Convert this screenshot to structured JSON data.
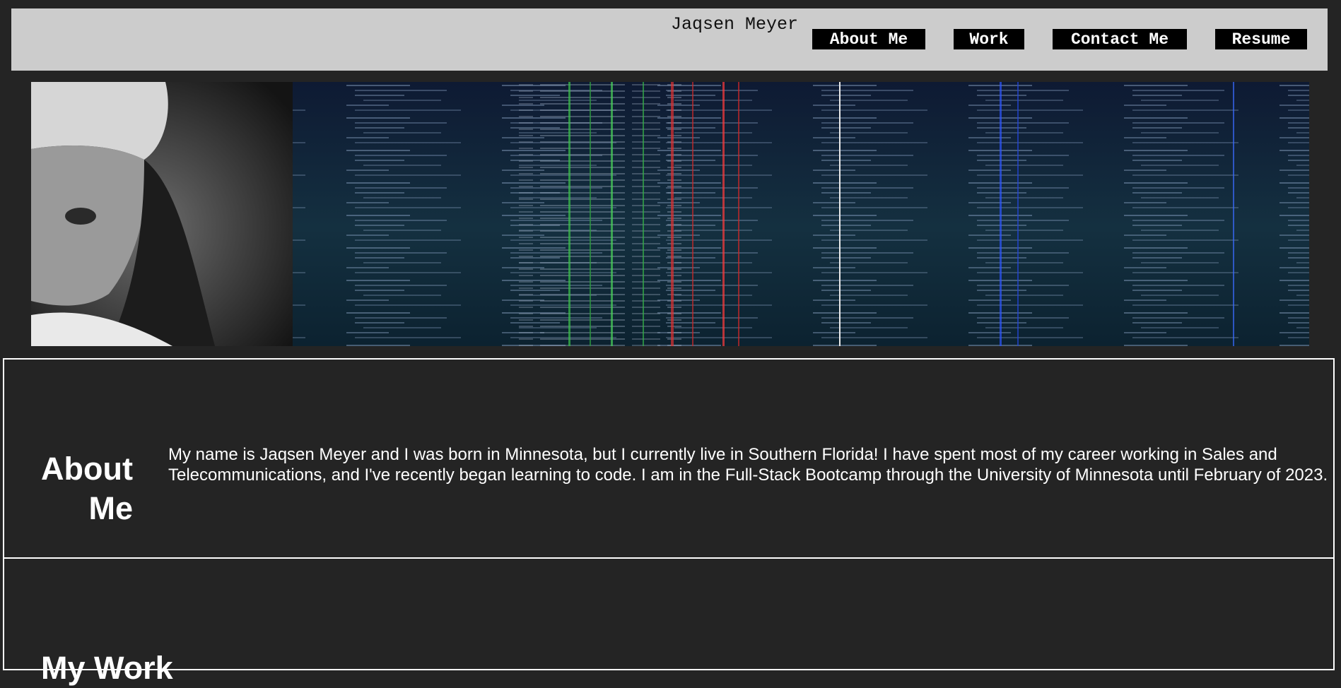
{
  "header": {
    "site_name": "Jaqsen Meyer",
    "nav": [
      {
        "label": "About Me"
      },
      {
        "label": "Work"
      },
      {
        "label": "Contact Me"
      },
      {
        "label": "Resume"
      }
    ]
  },
  "about": {
    "heading": "About Me",
    "body": "My name is Jaqsen Meyer and I was born in Minnesota, but I currently live in Southern Florida! I have spent most of my career working in Sales and Telecommunications, and I've recently began learning to code. I am in the Full-Stack Bootcamp through the University of Minnesota until February of 2023."
  },
  "work": {
    "heading": "My Work"
  },
  "colors": {
    "page_background": "#242424",
    "header_background": "#cccccc",
    "nav_button_background": "#000000",
    "nav_button_text": "#ffffff",
    "section_border": "#ffffff"
  }
}
